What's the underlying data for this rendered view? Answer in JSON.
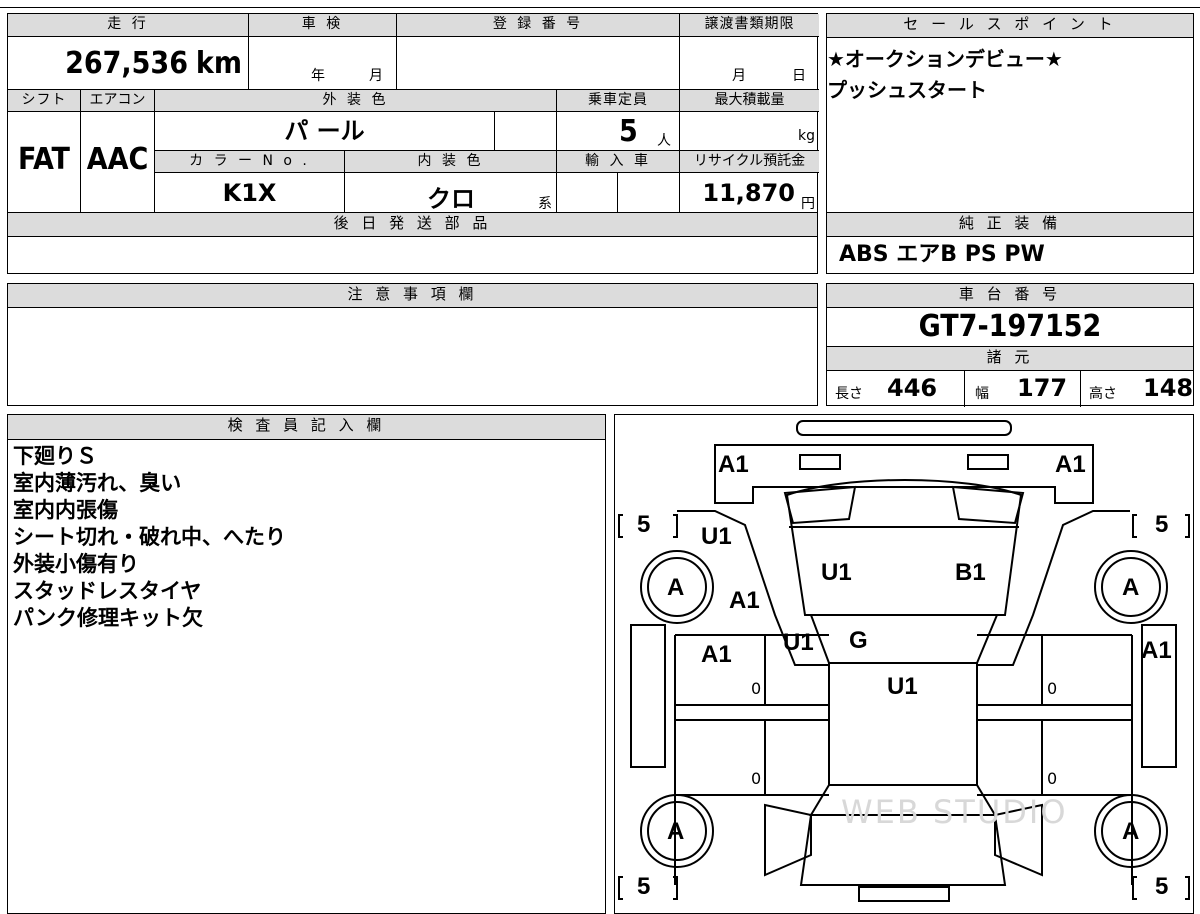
{
  "top_strip": {
    "partial": "…"
  },
  "mileage": {
    "header": "走 行",
    "value": "267,536",
    "unit": "km"
  },
  "inspection": {
    "header": "車 検",
    "year": "年",
    "month": "月"
  },
  "registration": {
    "header": "登 録 番 号",
    "value": ""
  },
  "transfer": {
    "header": "譲渡書類期限",
    "month": "月",
    "day": "日"
  },
  "shift": {
    "header": "シフト",
    "value": "FAT"
  },
  "aircon": {
    "header": "エアコン",
    "value": "AAC"
  },
  "exterior_color": {
    "header": "外 装 色",
    "value": "パ ール"
  },
  "capacity": {
    "header": "乗車定員",
    "value": "5",
    "unit": "人"
  },
  "max_load": {
    "header": "最大積載量",
    "unit": "kg"
  },
  "color_no": {
    "header": "カ ラ ー N o .",
    "value": "K1X"
  },
  "interior_color": {
    "header": "内 装 色",
    "value": "クロ",
    "suffix": "系"
  },
  "import": {
    "header": "輸 入 車"
  },
  "recycle": {
    "header": "リサイクル預託金",
    "value": "11,870",
    "unit": "円"
  },
  "later_parts": {
    "header": "後 日 発 送 部 品"
  },
  "sales_point": {
    "header": "セ ー ル ス ポ イ ン ト",
    "lines": [
      "★オークションデビュー★",
      "プッシュスタート"
    ]
  },
  "equipment": {
    "header": "純 正 装 備",
    "value": "ABS エアB PS PW"
  },
  "caution": {
    "header": "注 意 事 項 欄"
  },
  "chassis": {
    "header": "車 台 番 号",
    "value": "GT7-197152"
  },
  "specs": {
    "header": "諸 元",
    "length_label": "長さ",
    "length": "446",
    "width_label": "幅",
    "width": "177",
    "height_label": "高さ",
    "height": "148"
  },
  "inspector": {
    "header": "検 査 員 記 入 欄",
    "notes": [
      "下廻りＳ",
      "室内薄汚れ、臭い",
      "室内内張傷",
      "シート切れ・破れ中、へたり",
      "外装小傷有り",
      "スタッドレスタイヤ",
      "パンク修理キット欠"
    ]
  },
  "diagram": {
    "marks": {
      "front_left": "A1",
      "front_right": "A1",
      "fender_left": "U1",
      "fender_left2": "A1",
      "hood_left": "U1",
      "hood_right": "B1",
      "cowl": "U1",
      "windshield": "G",
      "door_front_left": "A1",
      "door_front_right": "A1",
      "roof": "U1"
    },
    "tires": [
      "A",
      "A",
      "A",
      "A"
    ],
    "tread": [
      "5",
      "5",
      "5",
      "5"
    ],
    "zeros": [
      "0",
      "0",
      "0",
      "0"
    ],
    "watermark": "WEB STUDIO"
  }
}
